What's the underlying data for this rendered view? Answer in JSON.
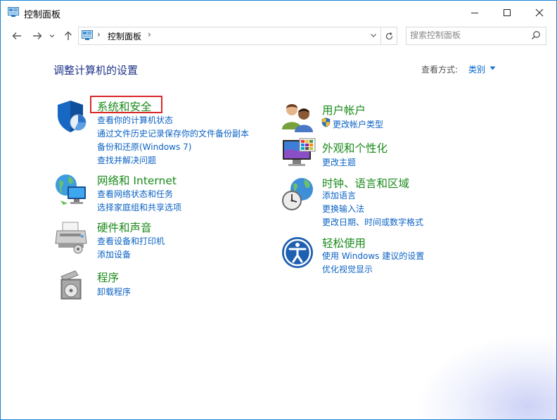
{
  "window": {
    "title": "控制面板"
  },
  "address": {
    "path": "控制面板",
    "separator": "›"
  },
  "search": {
    "placeholder": "搜索控制面板"
  },
  "main": {
    "heading": "调整计算机的设置",
    "view_by_label": "查看方式:",
    "view_by_value": "类别"
  },
  "categories": [
    {
      "title": "系统和安全",
      "icon": "system-security-shield-icon",
      "links": [
        "查看你的计算机状态",
        "通过文件历史记录保存你的文件备份副本",
        "备份和还原(Windows 7)",
        "查找并解决问题"
      ]
    },
    {
      "title": "网络和 Internet",
      "icon": "network-globe-icon",
      "links": [
        "查看网络状态和任务",
        "选择家庭组和共享选项"
      ]
    },
    {
      "title": "硬件和声音",
      "icon": "printer-hardware-icon",
      "links": [
        "查看设备和打印机",
        "添加设备"
      ]
    },
    {
      "title": "程序",
      "icon": "programs-disc-icon",
      "links": [
        "卸载程序"
      ]
    },
    {
      "title": "用户帐户",
      "icon": "user-accounts-icon",
      "links": [
        "更改帐户类型"
      ]
    },
    {
      "title": "外观和个性化",
      "icon": "monitor-personalization-icon",
      "links": [
        "更改主题"
      ]
    },
    {
      "title": "时钟、语言和区域",
      "icon": "clock-globe-icon",
      "links": [
        "添加语言",
        "更换输入法",
        "更改日期、时间或数字格式"
      ]
    },
    {
      "title": "轻松使用",
      "icon": "ease-of-access-icon",
      "links": [
        "使用 Windows 建议的设置",
        "优化视觉显示"
      ]
    }
  ],
  "colors": {
    "heading": "#1e3287",
    "category_title": "#1a8a1a",
    "link": "#0b62c4",
    "highlight_box": "#d8282a",
    "window_border": "#1883d7"
  }
}
